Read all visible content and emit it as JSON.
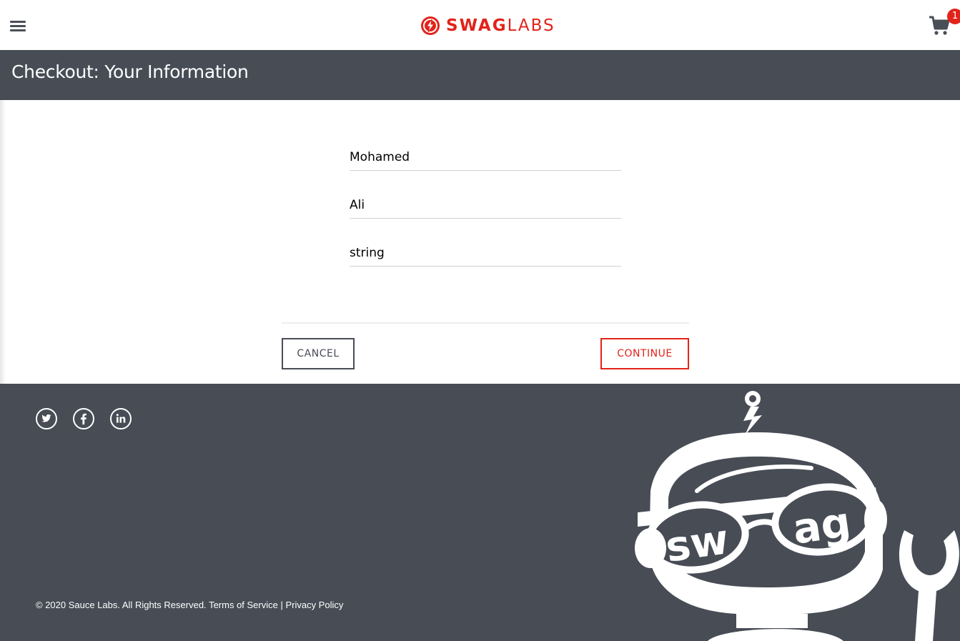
{
  "header": {
    "logo_bold": "SWAG",
    "logo_light": "LABS",
    "cart_count": "1"
  },
  "page": {
    "title": "Checkout: Your Information"
  },
  "form": {
    "first_name": "Mohamed",
    "last_name": "Ali",
    "postal_code": "string"
  },
  "actions": {
    "cancel_label": "CANCEL",
    "continue_label": "CONTINUE"
  },
  "footer": {
    "copyright": "© 2020 Sauce Labs. All Rights Reserved.",
    "terms": "Terms of Service",
    "separator": "|",
    "privacy": "Privacy Policy",
    "social": [
      "twitter-icon",
      "facebook-icon",
      "linkedin-icon"
    ],
    "robot_text_left": "sw",
    "robot_text_right": "ag"
  },
  "colors": {
    "brand_red": "#e2231a",
    "dark_gray": "#474c55"
  }
}
